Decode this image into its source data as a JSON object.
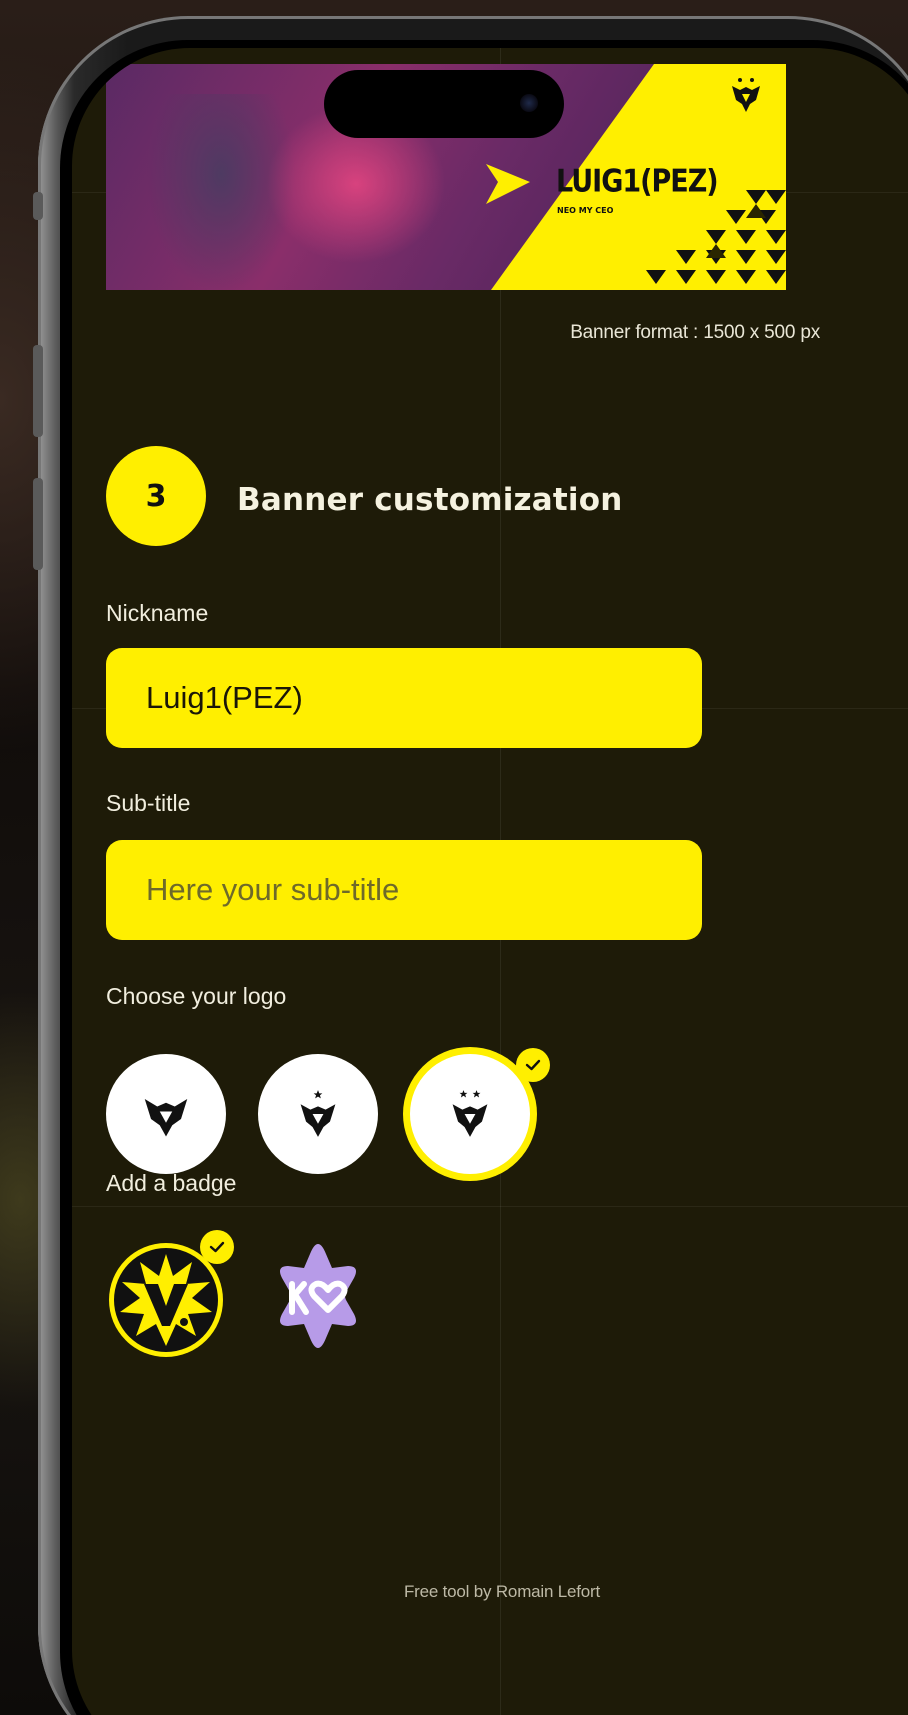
{
  "banner": {
    "nickname": "LUIG1(PEZ)",
    "subtitle": "NEO MY CEO",
    "format_text": "Banner format : 1500 x 500 px"
  },
  "step": {
    "number": "3",
    "title": "Banner customization"
  },
  "nickname_field": {
    "label": "Nickname",
    "value": "Luig1(PEZ)"
  },
  "subtitle_field": {
    "label": "Sub-title",
    "placeholder": "Here your sub-title",
    "value": ""
  },
  "logo_section": {
    "label": "Choose your logo",
    "options": [
      {
        "name": "vitality-bee-logo",
        "selected": false
      },
      {
        "name": "vitality-bee-one-star-logo",
        "selected": false
      },
      {
        "name": "vitality-bee-two-star-logo",
        "selected": true
      }
    ]
  },
  "badge_section": {
    "label": "Add a badge",
    "options": [
      {
        "name": "vitality-v-burst-badge",
        "selected": true
      },
      {
        "name": "ko-heart-star-badge",
        "selected": false
      }
    ]
  },
  "footer": {
    "text": "Free tool by Romain Lefort"
  },
  "colors": {
    "accent": "#ffef00",
    "screen_background": "#1e1b08",
    "badge_purple": "#b79be8"
  }
}
